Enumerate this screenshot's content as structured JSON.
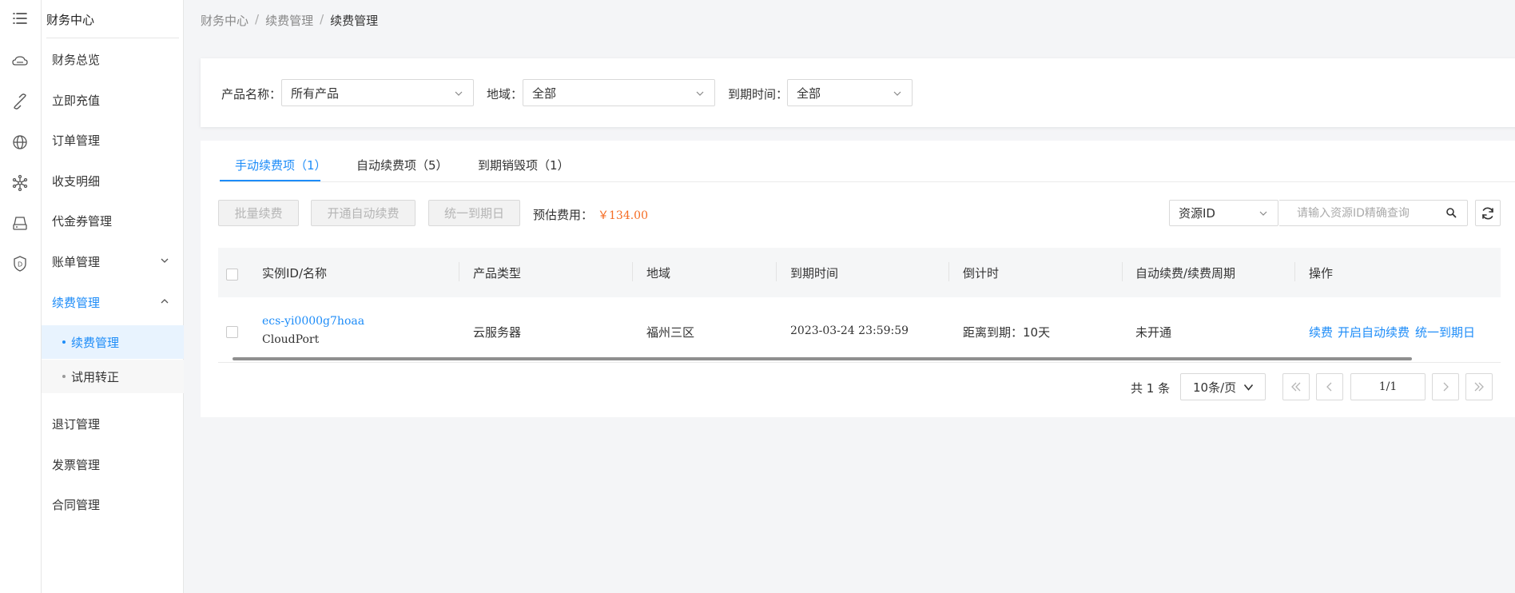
{
  "sidebar": {
    "title": "财务中心",
    "items": [
      {
        "label": "财务总览"
      },
      {
        "label": "立即充值"
      },
      {
        "label": "订单管理"
      },
      {
        "label": "收支明细"
      },
      {
        "label": "代金券管理"
      },
      {
        "label": "账单管理"
      },
      {
        "label": "续费管理"
      },
      {
        "label": "退订管理"
      },
      {
        "label": "发票管理"
      },
      {
        "label": "合同管理"
      }
    ],
    "subitems": [
      {
        "label": "续费管理"
      },
      {
        "label": "试用转正"
      }
    ]
  },
  "breadcrumb": [
    "财务中心",
    "/",
    "续费管理",
    "/",
    "续费管理"
  ],
  "filters": {
    "product_label": "产品名称：",
    "product_value": "所有产品",
    "region_label": "地域：",
    "region_value": "全部",
    "expiry_label": "到期时间：",
    "expiry_value": "全部"
  },
  "tabs": [
    {
      "label": "手动续费项（1）"
    },
    {
      "label": "自动续费项（5）"
    },
    {
      "label": "到期销毁项（1）"
    }
  ],
  "toolbar": {
    "batch_renew": "批量续费",
    "enable_auto_renew": "开通自动续费",
    "unify_expiry": "统一到期日",
    "estimate_label": "预估费用：",
    "estimate_value": "￥134.00",
    "search_type": "资源ID",
    "search_placeholder": "请输入资源ID精确查询"
  },
  "table": {
    "headers": [
      "实例ID/名称",
      "产品类型",
      "地域",
      "到期时间",
      "倒计时",
      "自动续费/续费周期",
      "操作"
    ],
    "rows": [
      {
        "instance_id": "ecs-yi0000g7hoaa",
        "name": "CloudPort",
        "product_type": "云服务器",
        "region": "福州三区",
        "expiry": "2023-03-24 23:59:59",
        "countdown": "距离到期：10天",
        "auto_renew": "未开通",
        "actions": [
          "续费",
          "开启自动续费",
          "统一到期日"
        ]
      }
    ]
  },
  "pagination": {
    "total": "共 1 条",
    "page_size": "10条/页",
    "current": "1/1"
  },
  "colors": {
    "accent": "#1d8cf8",
    "price": "#f56c23"
  }
}
